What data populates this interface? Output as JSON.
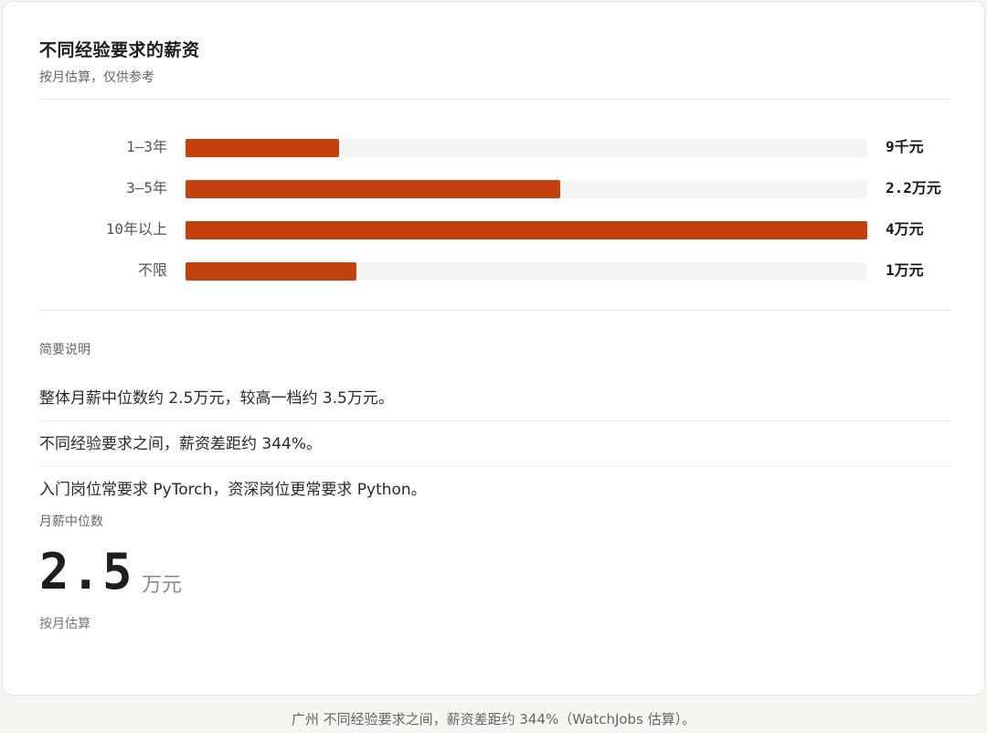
{
  "header": {
    "title": "不同经验要求的薪资",
    "subtitle": "按月估算，仅供参考"
  },
  "chart_data": {
    "type": "bar",
    "orientation": "horizontal",
    "categories": [
      "1–3年",
      "3–5年",
      "10年以上",
      "不限"
    ],
    "values": [
      0.9,
      2.2,
      4.0,
      1.0
    ],
    "value_labels": [
      "9千元",
      "2.2万元",
      "4万元",
      "1万元"
    ],
    "unit": "万元",
    "xlim": [
      0,
      4.0
    ],
    "bar_color": "#c2410c",
    "track_color": "#f4f4f4",
    "grid": false
  },
  "notes": {
    "heading": "简要说明",
    "items": [
      "整体月薪中位数约 2.5万元，较高一档约 3.5万元。",
      "不同经验要求之间，薪资差距约 344%。",
      "入门岗位常要求 PyTorch，资深岗位更常要求 Python。"
    ]
  },
  "median": {
    "label": "月薪中位数",
    "value": "2.5",
    "unit": "万元",
    "note": "按月估算"
  },
  "footer": {
    "text": "广州 不同经验要求之间，薪资差距约 344%（WatchJobs 估算）。"
  }
}
